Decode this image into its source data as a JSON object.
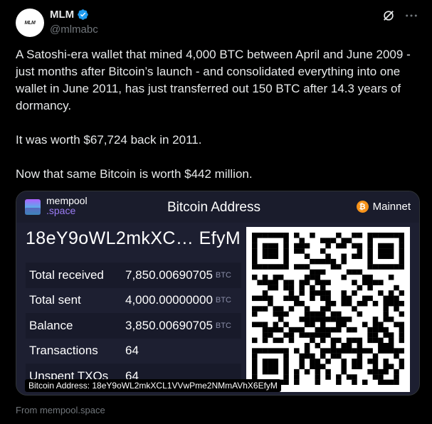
{
  "author": {
    "name": "MLM",
    "handle": "@mlmabc",
    "avatar_text": "MLM"
  },
  "tweet": {
    "text": "A Satoshi-era wallet that mined 4,000 BTC between April and June 2009 - just months after Bitcoin’s launch - and consolidated everything into one wallet in June 2011, has just transferred out 150 BTC after 14.3 years of dormancy.\n\nIt was worth $67,724 back in 2011.\n\nNow that same Bitcoin is worth $442 million."
  },
  "card": {
    "logo_line1": "mempool",
    "logo_line2": ".space",
    "title": "Bitcoin Address",
    "network": "Mainnet",
    "network_icon": "₿",
    "address_short": "18eY9oWL2mkXC…  EfyM",
    "rows": [
      {
        "label": "Total received",
        "value": "7,850.00690705",
        "unit": "BTC"
      },
      {
        "label": "Total sent",
        "value": "4,000.00000000",
        "unit": "BTC"
      },
      {
        "label": "Balance",
        "value": "3,850.00690705",
        "unit": "BTC"
      },
      {
        "label": "Transactions",
        "value": "64",
        "unit": ""
      },
      {
        "label": "Unspent TXOs",
        "value": "64",
        "unit": ""
      }
    ],
    "caption": "Bitcoin Address: 18eY9oWL2mkXCL1VVwPme2NMmAVhX6EfyM"
  },
  "source": "From mempool.space",
  "colors": {
    "background": "#000000",
    "text": "#e7e9ea",
    "secondary": "#71767b",
    "verified": "#1d9bf0",
    "card_bg": "#1d1f31",
    "accent_purple": "#9b7cf5",
    "bitcoin_orange": "#f7931a"
  },
  "icons": [
    "verified-badge-icon",
    "grok-icon",
    "more-icon",
    "mempool-logo-icon",
    "bitcoin-icon",
    "qr-code"
  ]
}
